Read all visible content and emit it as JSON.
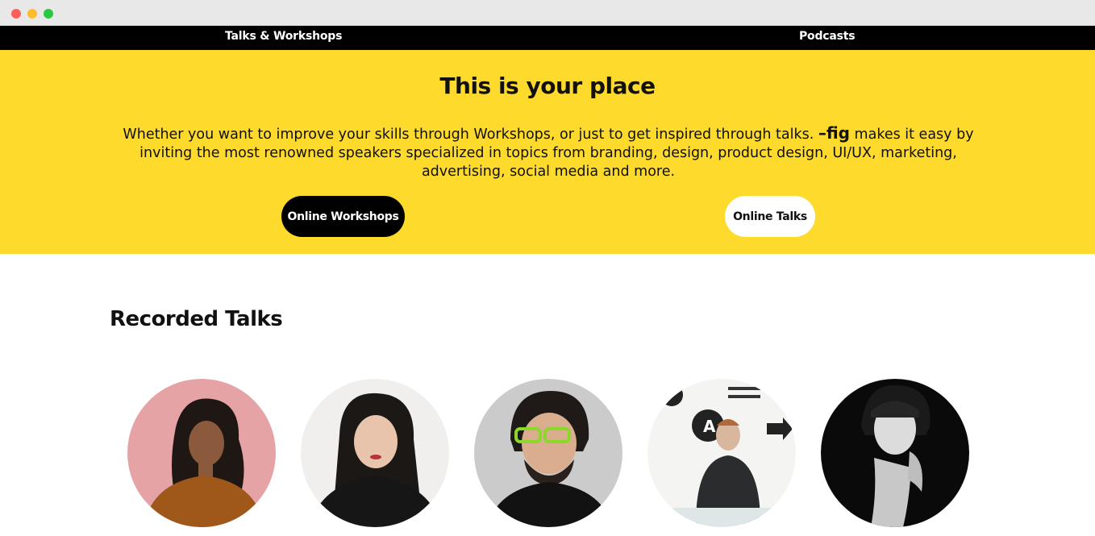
{
  "nav": {
    "talks_workshops": "Talks & Workshops",
    "podcasts": "Podcasts"
  },
  "hero": {
    "title": "This is your place",
    "text_before": "Whether you want to improve your skills through Workshops, or just to get inspired through talks. ",
    "brand": "–fig",
    "text_after": " makes it easy by inviting the most renowned speakers specialized in topics from branding, design, product design, UI/UX, marketing, advertising, social media and more.",
    "button_workshops": "Online Workshops",
    "button_talks": "Online Talks"
  },
  "recorded": {
    "title": "Recorded Talks",
    "speakers": [
      {
        "photo": "speaker-photo-1"
      },
      {
        "photo": "speaker-photo-2"
      },
      {
        "photo": "speaker-photo-3"
      },
      {
        "photo": "speaker-photo-4"
      },
      {
        "photo": "speaker-photo-5"
      }
    ]
  },
  "colors": {
    "accent_yellow": "#fdda2b",
    "nav_black": "#000000",
    "text": "#111111"
  }
}
